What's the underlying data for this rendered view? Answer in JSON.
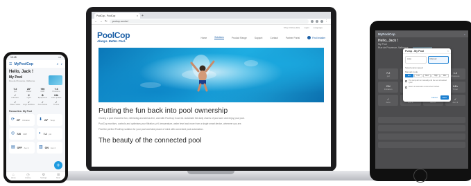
{
  "laptop": {
    "browser": {
      "tab_title": "PoolCop - PoolCop",
      "tab_close": "×",
      "tab_new": "+",
      "back_icon": "back-arrow-icon",
      "forward_icon": "forward-arrow-icon",
      "reload_icon": "reload-icon",
      "url": "poolcop.com/en/"
    },
    "site": {
      "utility_links": [
        "Shop Online (EU)",
        "Login",
        "Language"
      ],
      "logo_title": "PoolCop",
      "logo_tagline": "Always. Better. Pool.",
      "nav": [
        "Home",
        "Solutions",
        "Product Range",
        "Support",
        "Contact",
        "Partner Portal"
      ],
      "nav_active": "Solutions",
      "find_installer": "Find Installer",
      "article_title": "Putting the fun back into pool ownership",
      "paragraphs": [
        "Owning a pool should be fun, refreshing and stress-free, and with PoolCop it can be. Automate the daily chores of pool care and enjoy your pool.",
        "PoolCop monitors, controls and optimises your filtration, pH, temperature, water level and more from a single smart device, wherever you are.",
        "Find the perfect PoolCop solution for your pool and take peace of mind with connected pool automation."
      ],
      "article_subtitle": "The beauty of the connected pool"
    }
  },
  "phone": {
    "status_time": "10:45",
    "status_icons": "▪▪▪",
    "brand": "MyPoolCop",
    "greeting": "Hello, Jack !",
    "pool_name": "My Pool",
    "pool_address": "Rue de Provence, Valbonne",
    "metrics": [
      {
        "value": "7.2",
        "label": "pH"
      },
      {
        "value": "28°",
        "label": "Water"
      },
      {
        "value": "750",
        "label": "ORP"
      },
      {
        "value": "7.6",
        "label": "Pressure"
      },
      {
        "value": "✓",
        "label": "Filtration"
      },
      {
        "value": "☀",
        "label": "Light"
      },
      {
        "value": "⚙",
        "label": "Equipment"
      },
      {
        "value": "24h",
        "label": "Last update"
      },
      {
        "value": "✓",
        "label": "Water Valve"
      },
      {
        "value": "✓",
        "label": "High Bubbles"
      },
      {
        "value": "✓",
        "label": "Auto Mode"
      },
      {
        "value": "✓",
        "label": "Timers"
      }
    ],
    "section_title": "Favourites: My Pool",
    "cards": [
      {
        "icon": "⟳",
        "title": "20°",
        "sub": "Filtration"
      },
      {
        "icon": "⬇",
        "title": "24°",
        "sub": "Temp"
      },
      {
        "icon": "◎",
        "title": "720",
        "sub": "ORP"
      },
      {
        "icon": "◐",
        "title": "7.2",
        "sub": "pH"
      },
      {
        "icon": "▤",
        "title": "OFF",
        "sub": "Aux 1"
      },
      {
        "icon": "▥",
        "title": "ON",
        "sub": "Aux 2"
      }
    ],
    "fab": "+",
    "tabs": [
      {
        "icon": "⌂",
        "label": "Home"
      },
      {
        "icon": "◷",
        "label": "History"
      },
      {
        "icon": "⚙",
        "label": "Settings"
      },
      {
        "icon": "☰",
        "label": "More"
      }
    ]
  },
  "tablet": {
    "brand": "MyPoolCop",
    "greeting": "Hello, Jack !",
    "pool_name": "My Pool",
    "pool_address": "Rue de Provence, Valbonne",
    "grid": [
      {
        "value": "7.2",
        "label": "pH"
      },
      {
        "value": "28°",
        "label": "Water"
      },
      {
        "value": "750",
        "label": "ORP"
      },
      {
        "value": "1.2",
        "label": "Pressure"
      },
      {
        "value": "ON",
        "label": "Filtration"
      },
      {
        "value": "OFF",
        "label": "Light"
      },
      {
        "value": "ON",
        "label": "Valve"
      },
      {
        "value": "24h",
        "label": "Timer"
      },
      {
        "value": "✓",
        "label": "Auto"
      },
      {
        "value": "✓",
        "label": "Aux 1"
      },
      {
        "value": "✓",
        "label": "Aux 2"
      },
      {
        "value": "✓",
        "label": "Aux 3"
      }
    ],
    "modal": {
      "title": "Pump - My Pool",
      "close": "×",
      "options": [
        "Auto",
        "Manual"
      ],
      "speed_label": "Select pump speed",
      "mode_label": "Manual mode",
      "segments": [
        "Eco",
        "Low",
        "Med",
        "High",
        "Max"
      ],
      "segment_active": "Eco",
      "notes": [
        "The pump will run manually until the next scheduled cycle.",
        "Return to automatic control when finished."
      ],
      "cancel": "Cancel",
      "save": "Save"
    }
  }
}
